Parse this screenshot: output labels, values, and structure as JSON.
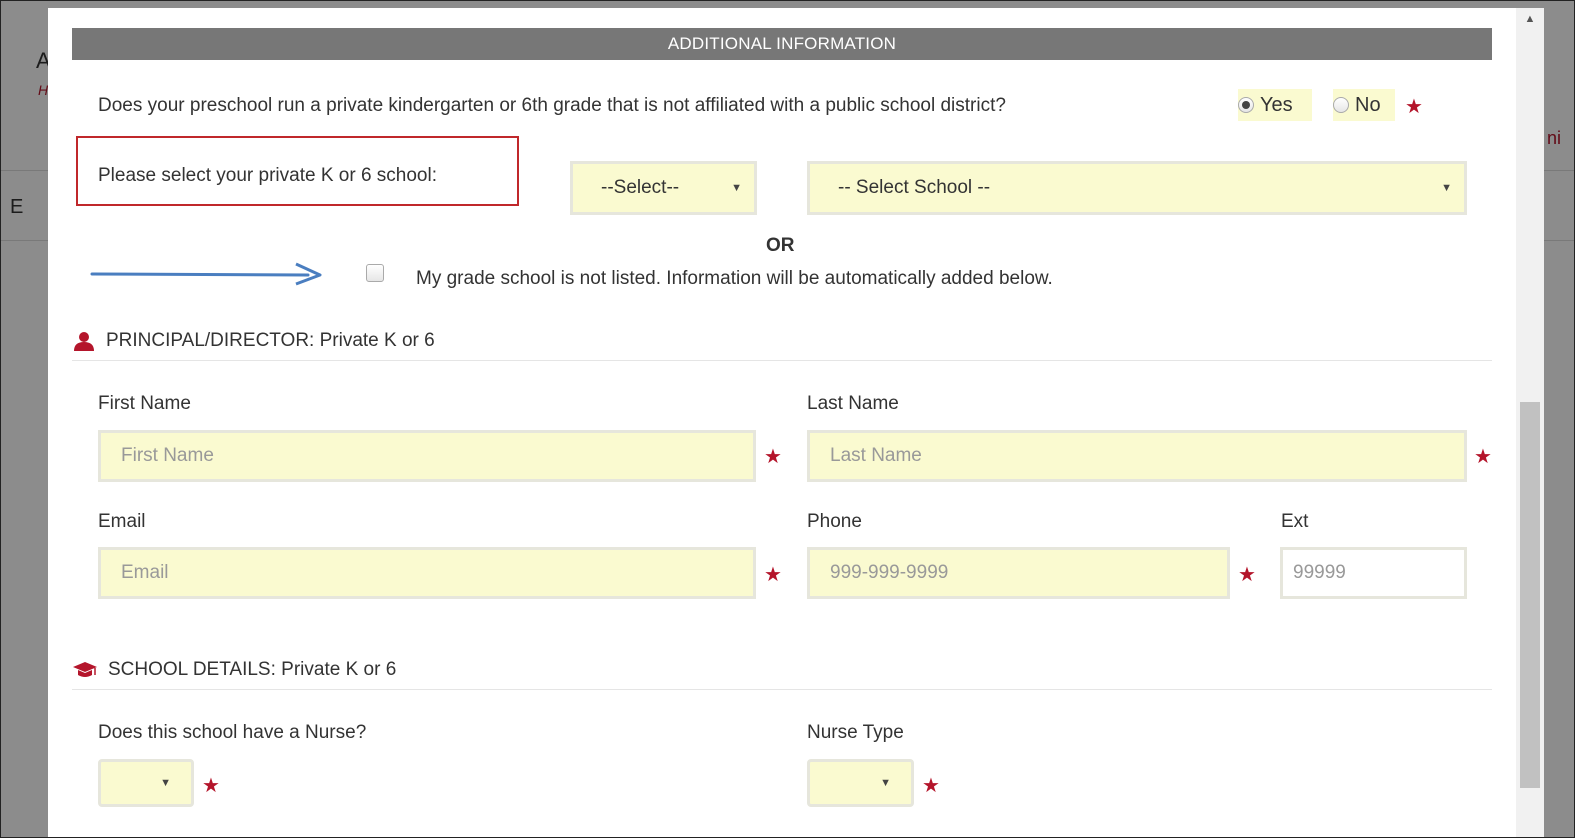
{
  "background": {
    "letter_a": "A",
    "letter_h": "H",
    "letter_e": "E",
    "fragment_right": "ni"
  },
  "banner": {
    "title": "ADDITIONAL INFORMATION"
  },
  "question": {
    "text": "Does your preschool run a private kindergarten or 6th grade that is not affiliated with a public school district?",
    "options": [
      {
        "label": "Yes",
        "checked": true
      },
      {
        "label": "No",
        "checked": false
      }
    ],
    "required_mark": "★"
  },
  "school_select": {
    "label": "Please select your private K or 6 school:",
    "type_select": "--Select--",
    "school_select": "-- Select School --"
  },
  "or_text": "OR",
  "not_listed": {
    "label": "My grade school is not listed. Information will be automatically added below.",
    "checked": false
  },
  "principal_section": {
    "title": "PRINCIPAL/DIRECTOR: Private K or 6",
    "icon": "user-icon",
    "first_name": {
      "label": "First Name",
      "placeholder": "First Name"
    },
    "last_name": {
      "label": "Last Name",
      "placeholder": "Last Name"
    },
    "email": {
      "label": "Email",
      "placeholder": "Email"
    },
    "phone": {
      "label": "Phone",
      "placeholder": "999-999-9999"
    },
    "ext": {
      "label": "Ext",
      "placeholder": "99999"
    }
  },
  "school_section": {
    "title": "SCHOOL DETAILS: Private K or 6",
    "icon": "graduation-cap-icon",
    "nurse_question": {
      "label": "Does this school have a Nurse?",
      "value": ""
    },
    "nurse_type": {
      "label": "Nurse Type",
      "value": ""
    }
  },
  "colors": {
    "banner_bg": "#777777",
    "field_bg": "#fafad0",
    "required": "#b4152b",
    "highlight_box": "#c0282b",
    "arrow": "#4a7ec0"
  }
}
